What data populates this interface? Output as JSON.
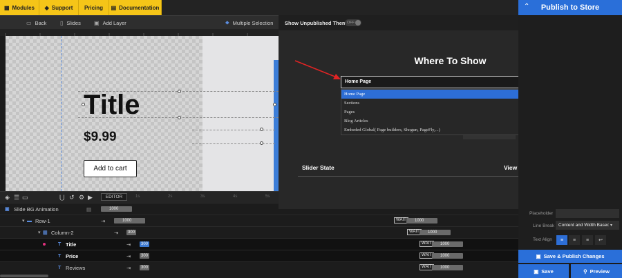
{
  "topnav": {
    "modules": "Modules",
    "support": "Support",
    "pricing": "Pricing",
    "documentation": "Documentation"
  },
  "subbar": {
    "back": "Back",
    "slides": "Slides",
    "add_layer": "Add Layer",
    "multiple_selection": "Multiple Selection"
  },
  "ruler": {
    "ticks": [
      "100",
      "200",
      "300",
      "400",
      "500",
      "600",
      "700"
    ]
  },
  "slide": {
    "title": "Title",
    "price": "$9.99",
    "cart_button": "Add to cart"
  },
  "timeline": {
    "editor_label": "EDITOR",
    "time_ticks": [
      "1s",
      "2s",
      "3s",
      "4s",
      "5s"
    ],
    "rows": [
      {
        "name": "Slide BG Animation",
        "duration": "1000",
        "wait": ""
      },
      {
        "name": "Row-1",
        "duration": "1000",
        "wait": "WAIT",
        "wait_duration": "1000"
      },
      {
        "name": "Column-2",
        "duration": "300",
        "wait": "WAIT",
        "wait_duration": "1000"
      },
      {
        "name": "Title",
        "duration": "300",
        "wait": "WAIT",
        "wait_duration": "1000"
      },
      {
        "name": "Price",
        "duration": "300",
        "wait": "WAIT",
        "wait_duration": "1000"
      },
      {
        "name": "Reviews",
        "duration": "300",
        "wait": "WAIT",
        "wait_duration": "1000"
      }
    ]
  },
  "modal": {
    "header_label": "Show Unpublished Themes",
    "toggle_state": "OFF",
    "title": "Where To Show",
    "select_value": "Home Page",
    "options": [
      "Home Page",
      "Sections",
      "Pages",
      "Blog Articles",
      "Embeded Global( Page builders, Shogun, PageFly,...)"
    ],
    "col_slider_state": "Slider State",
    "col_view_remove": "View / Remove"
  },
  "right_panel": {
    "publish": "Publish to Store",
    "placeholder_label": "Placeholder",
    "line_break_label": "Line Break",
    "line_break_value": "Content and Width Based",
    "text_align_label": "Text Align",
    "save_publish": "Save & Publish Changes",
    "save": "Save",
    "preview": "Preview"
  },
  "colors": {
    "accent": "#2a6fd9",
    "nav_yellow": "#f5c518",
    "arrow_red": "#e02424"
  }
}
